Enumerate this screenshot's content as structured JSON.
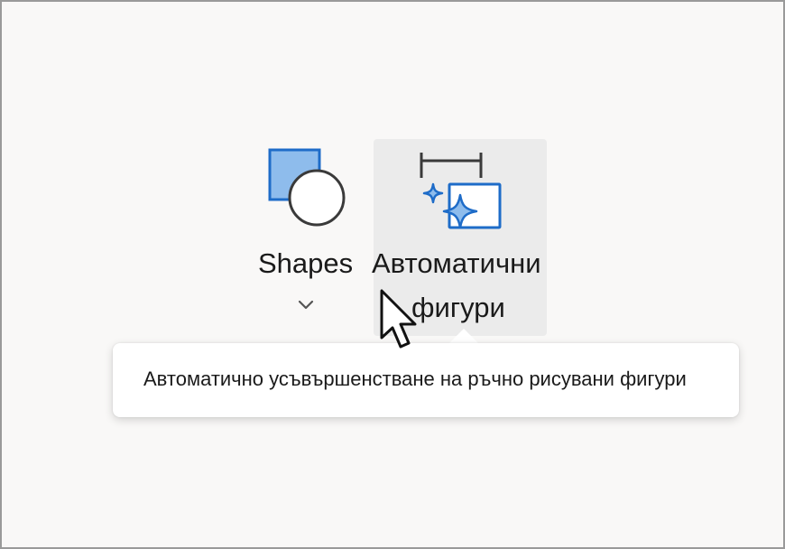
{
  "ribbon": {
    "shapes": {
      "label": "Shapes",
      "icon": "shapes-icon"
    },
    "autoshapes": {
      "label_line1": "Автоматични",
      "label_line2": "фигури",
      "icon": "auto-shapes-icon"
    }
  },
  "tooltip": {
    "text": "Автоматично усъвършенстване на ръчно рисувани фигури"
  },
  "colors": {
    "accent_blue": "#1e6cc8",
    "accent_fill": "#8ebcec",
    "hover_bg": "#ebebeb",
    "background": "#f9f8f7"
  }
}
